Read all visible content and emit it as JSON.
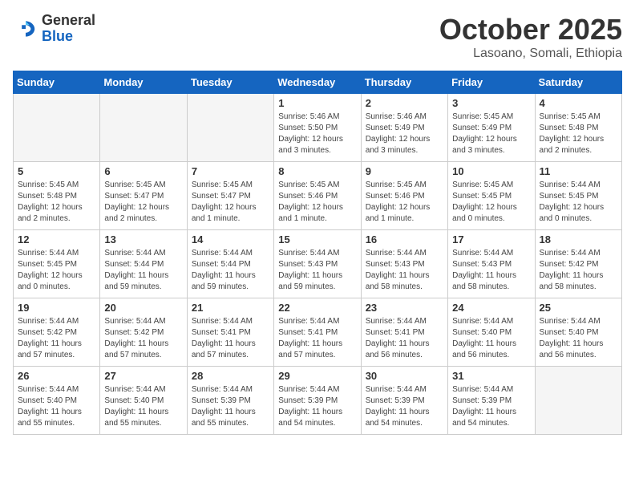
{
  "header": {
    "logo_line1": "General",
    "logo_line2": "Blue",
    "month": "October 2025",
    "location": "Lasoano, Somali, Ethiopia"
  },
  "weekdays": [
    "Sunday",
    "Monday",
    "Tuesday",
    "Wednesday",
    "Thursday",
    "Friday",
    "Saturday"
  ],
  "weeks": [
    [
      {
        "day": "",
        "info": ""
      },
      {
        "day": "",
        "info": ""
      },
      {
        "day": "",
        "info": ""
      },
      {
        "day": "1",
        "info": "Sunrise: 5:46 AM\nSunset: 5:50 PM\nDaylight: 12 hours and 3 minutes."
      },
      {
        "day": "2",
        "info": "Sunrise: 5:46 AM\nSunset: 5:49 PM\nDaylight: 12 hours and 3 minutes."
      },
      {
        "day": "3",
        "info": "Sunrise: 5:45 AM\nSunset: 5:49 PM\nDaylight: 12 hours and 3 minutes."
      },
      {
        "day": "4",
        "info": "Sunrise: 5:45 AM\nSunset: 5:48 PM\nDaylight: 12 hours and 2 minutes."
      }
    ],
    [
      {
        "day": "5",
        "info": "Sunrise: 5:45 AM\nSunset: 5:48 PM\nDaylight: 12 hours and 2 minutes."
      },
      {
        "day": "6",
        "info": "Sunrise: 5:45 AM\nSunset: 5:47 PM\nDaylight: 12 hours and 2 minutes."
      },
      {
        "day": "7",
        "info": "Sunrise: 5:45 AM\nSunset: 5:47 PM\nDaylight: 12 hours and 1 minute."
      },
      {
        "day": "8",
        "info": "Sunrise: 5:45 AM\nSunset: 5:46 PM\nDaylight: 12 hours and 1 minute."
      },
      {
        "day": "9",
        "info": "Sunrise: 5:45 AM\nSunset: 5:46 PM\nDaylight: 12 hours and 1 minute."
      },
      {
        "day": "10",
        "info": "Sunrise: 5:45 AM\nSunset: 5:45 PM\nDaylight: 12 hours and 0 minutes."
      },
      {
        "day": "11",
        "info": "Sunrise: 5:44 AM\nSunset: 5:45 PM\nDaylight: 12 hours and 0 minutes."
      }
    ],
    [
      {
        "day": "12",
        "info": "Sunrise: 5:44 AM\nSunset: 5:45 PM\nDaylight: 12 hours and 0 minutes."
      },
      {
        "day": "13",
        "info": "Sunrise: 5:44 AM\nSunset: 5:44 PM\nDaylight: 11 hours and 59 minutes."
      },
      {
        "day": "14",
        "info": "Sunrise: 5:44 AM\nSunset: 5:44 PM\nDaylight: 11 hours and 59 minutes."
      },
      {
        "day": "15",
        "info": "Sunrise: 5:44 AM\nSunset: 5:43 PM\nDaylight: 11 hours and 59 minutes."
      },
      {
        "day": "16",
        "info": "Sunrise: 5:44 AM\nSunset: 5:43 PM\nDaylight: 11 hours and 58 minutes."
      },
      {
        "day": "17",
        "info": "Sunrise: 5:44 AM\nSunset: 5:43 PM\nDaylight: 11 hours and 58 minutes."
      },
      {
        "day": "18",
        "info": "Sunrise: 5:44 AM\nSunset: 5:42 PM\nDaylight: 11 hours and 58 minutes."
      }
    ],
    [
      {
        "day": "19",
        "info": "Sunrise: 5:44 AM\nSunset: 5:42 PM\nDaylight: 11 hours and 57 minutes."
      },
      {
        "day": "20",
        "info": "Sunrise: 5:44 AM\nSunset: 5:42 PM\nDaylight: 11 hours and 57 minutes."
      },
      {
        "day": "21",
        "info": "Sunrise: 5:44 AM\nSunset: 5:41 PM\nDaylight: 11 hours and 57 minutes."
      },
      {
        "day": "22",
        "info": "Sunrise: 5:44 AM\nSunset: 5:41 PM\nDaylight: 11 hours and 57 minutes."
      },
      {
        "day": "23",
        "info": "Sunrise: 5:44 AM\nSunset: 5:41 PM\nDaylight: 11 hours and 56 minutes."
      },
      {
        "day": "24",
        "info": "Sunrise: 5:44 AM\nSunset: 5:40 PM\nDaylight: 11 hours and 56 minutes."
      },
      {
        "day": "25",
        "info": "Sunrise: 5:44 AM\nSunset: 5:40 PM\nDaylight: 11 hours and 56 minutes."
      }
    ],
    [
      {
        "day": "26",
        "info": "Sunrise: 5:44 AM\nSunset: 5:40 PM\nDaylight: 11 hours and 55 minutes."
      },
      {
        "day": "27",
        "info": "Sunrise: 5:44 AM\nSunset: 5:40 PM\nDaylight: 11 hours and 55 minutes."
      },
      {
        "day": "28",
        "info": "Sunrise: 5:44 AM\nSunset: 5:39 PM\nDaylight: 11 hours and 55 minutes."
      },
      {
        "day": "29",
        "info": "Sunrise: 5:44 AM\nSunset: 5:39 PM\nDaylight: 11 hours and 54 minutes."
      },
      {
        "day": "30",
        "info": "Sunrise: 5:44 AM\nSunset: 5:39 PM\nDaylight: 11 hours and 54 minutes."
      },
      {
        "day": "31",
        "info": "Sunrise: 5:44 AM\nSunset: 5:39 PM\nDaylight: 11 hours and 54 minutes."
      },
      {
        "day": "",
        "info": ""
      }
    ]
  ]
}
